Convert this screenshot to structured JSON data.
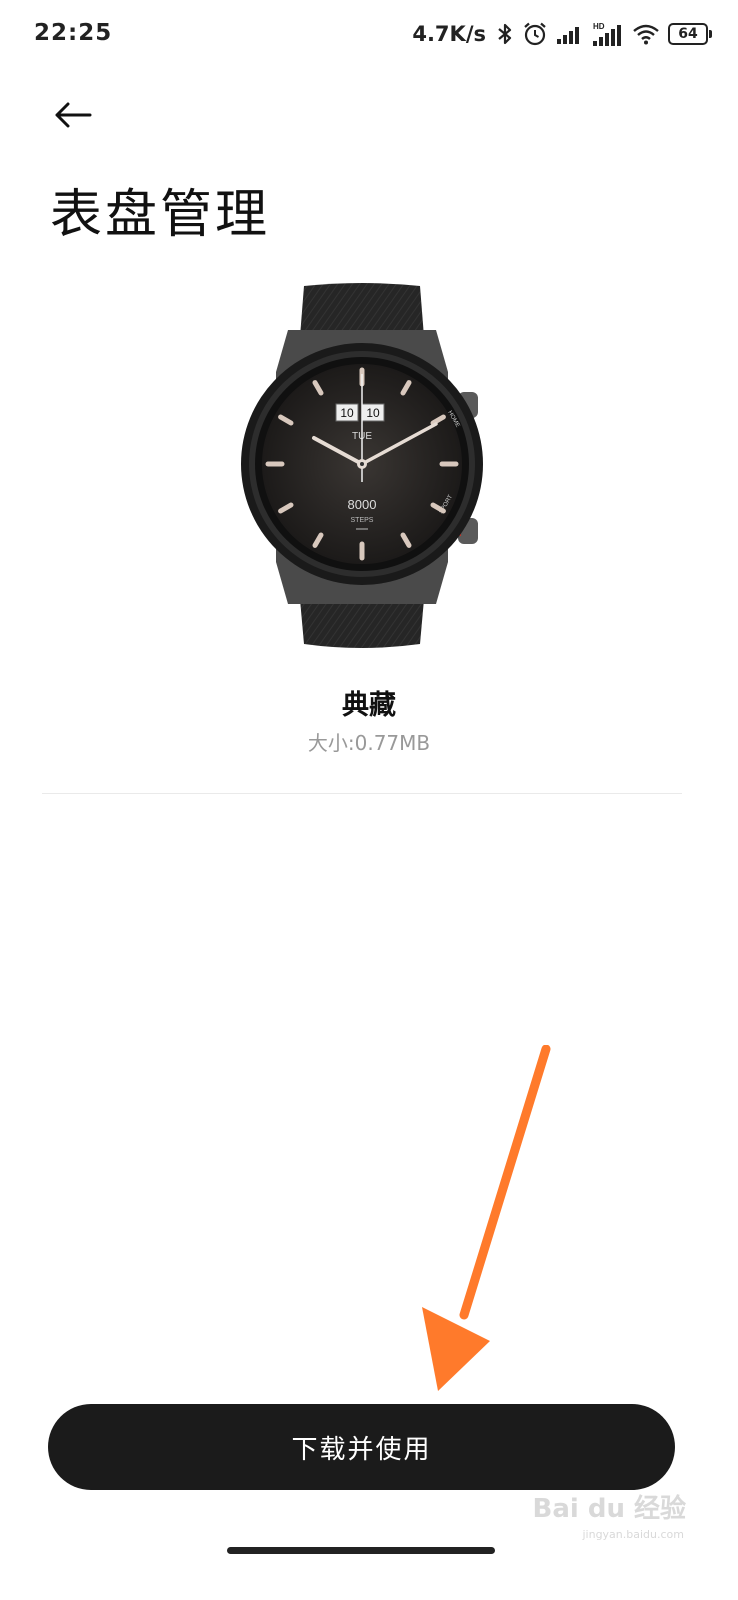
{
  "status_bar": {
    "time": "22:25",
    "net_speed": "4.7K/s",
    "battery": "64",
    "icons": [
      "bluetooth-icon",
      "alarm-icon",
      "signal-icon",
      "hd-signal-icon",
      "wifi-icon",
      "battery-icon"
    ]
  },
  "header": {
    "back_icon": "arrow-left-icon",
    "title": "表盘管理"
  },
  "watch_face": {
    "date_day_1": "10",
    "date_day_2": "10",
    "weekday": "TUE",
    "steps_value": "8000",
    "steps_label": "STEPS",
    "button_top_label": "HOME",
    "button_bottom_label": "SPORT",
    "name": "典藏",
    "size": "大小:0.77MB"
  },
  "action": {
    "button_label": "下载并使用"
  },
  "watermark": {
    "text": "Bai du 经验",
    "sub": "jingyan.baidu.com"
  },
  "colors": {
    "accent_arrow": "#ff7a2b",
    "button_bg": "#1b1b1b"
  }
}
